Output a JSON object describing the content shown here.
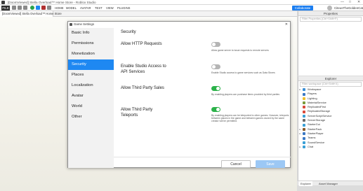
{
  "window": {
    "title": "[DoomViewed] Stella Overload™ Home Store - Roblox Studio",
    "controls": [
      "—",
      "□",
      "✕"
    ]
  },
  "menubar": {
    "file": "FILE",
    "tabs": [
      "HOME",
      "MODEL",
      "AVATAR",
      "TEST",
      "VIEW",
      "PLUGINS"
    ],
    "collaborate": "Collaborate",
    "username": "CiteusTheGoldenCat"
  },
  "doc_tab": "[DoomViewed] Stella Overload™ Home Store",
  "properties": {
    "title": "Properties",
    "filter_placeholder": "Filter Properties (Ctrl+Shift+P)"
  },
  "explorer": {
    "title": "Explorer",
    "filter_placeholder": "Filter workspace (Ctrl+Shift+X)",
    "items": [
      {
        "label": "Workspace",
        "color": "#3b8fd6",
        "expandable": true
      },
      {
        "label": "Players",
        "color": "#3a78c4",
        "expandable": false
      },
      {
        "label": "Lighting",
        "color": "#f0c030",
        "expandable": false
      },
      {
        "label": "MaterialService",
        "color": "#7a9a3a",
        "expandable": false
      },
      {
        "label": "ReplicatedFirst",
        "color": "#d94a3a",
        "expandable": false
      },
      {
        "label": "ReplicatedStorage",
        "color": "#d94a3a",
        "expandable": false
      },
      {
        "label": "ServerScriptService",
        "color": "#3aa0d6",
        "expandable": false
      },
      {
        "label": "ServerStorage",
        "color": "#6a6a6a",
        "expandable": false
      },
      {
        "label": "StarterGui",
        "color": "#3aa0d6",
        "expandable": false
      },
      {
        "label": "StarterPack",
        "color": "#8a5a2a",
        "expandable": true
      },
      {
        "label": "StarterPlayer",
        "color": "#3a78c4",
        "expandable": true
      },
      {
        "label": "Teams",
        "color": "#3a78c4",
        "expandable": false
      },
      {
        "label": "SoundService",
        "color": "#3aa0d6",
        "expandable": false
      },
      {
        "label": "Chat",
        "color": "#3aa0d6",
        "expandable": true
      }
    ]
  },
  "bottom_tabs": [
    "Explorer",
    "Asset Manager"
  ],
  "dialog": {
    "title": "Game Settings",
    "close": "✕",
    "sidebar": [
      "Basic Info",
      "Permissions",
      "Monetization",
      "Security",
      "Places",
      "Localization",
      "Avatar",
      "World",
      "Other"
    ],
    "active_index": 3,
    "section_title": "Security",
    "settings": [
      {
        "label": "Allow HTTP Requests",
        "enabled": false,
        "description": "Allow game server to issue requests to remote servers"
      },
      {
        "label": "Enable Studio Access to API Services",
        "enabled": false,
        "description": "Enable Studio access to game services such as Data Stores"
      },
      {
        "label": "Allow Third Party Sales",
        "enabled": true,
        "description": "By enabling players can purchase items provided by third parties"
      },
      {
        "label": "Allow Third Party Teleports",
        "enabled": true,
        "description": "By enabling players can be teleported to other games. However, teleports between places in the game and between games owned by the same creator will be permitted."
      }
    ],
    "buttons": {
      "cancel": "Cancel",
      "save": "Save"
    }
  }
}
